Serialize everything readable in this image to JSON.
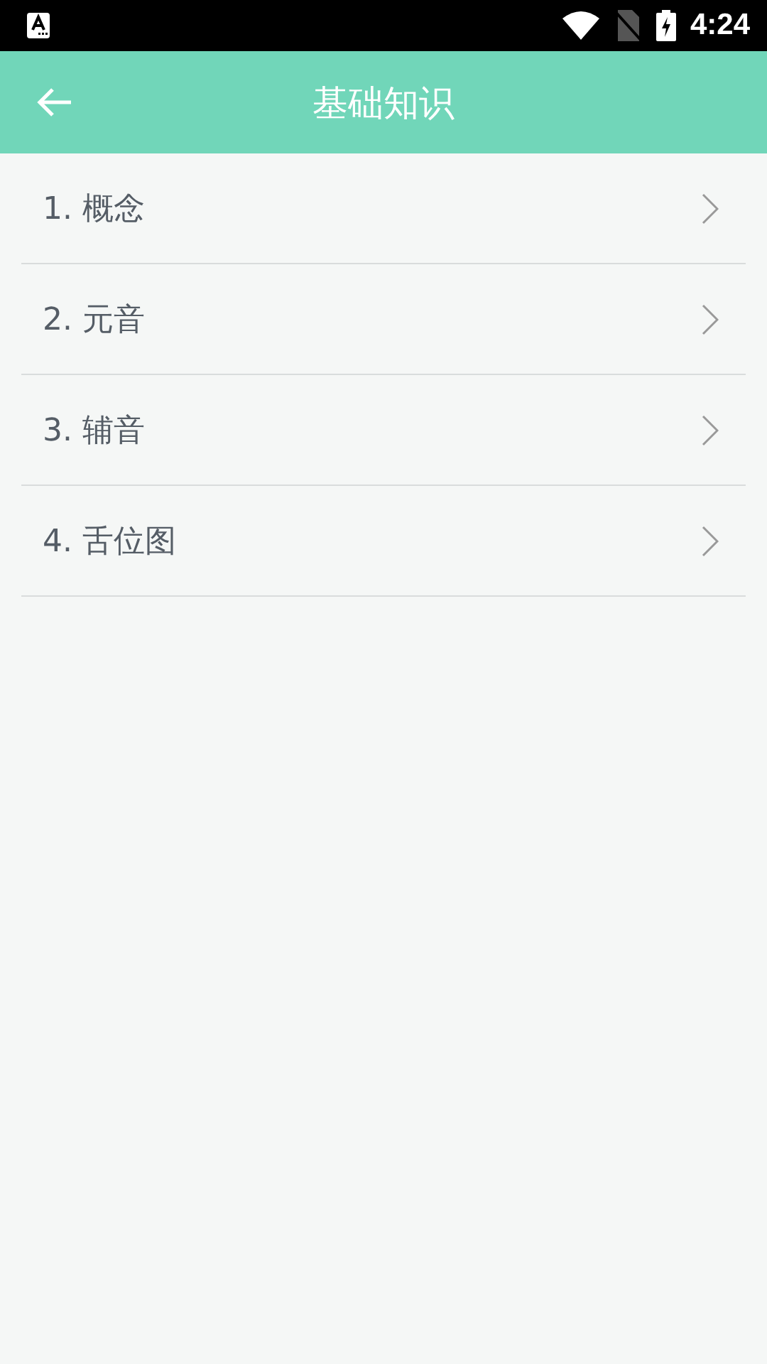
{
  "status_bar": {
    "time": "4:24"
  },
  "app_bar": {
    "title": "基础知识"
  },
  "items": [
    {
      "label": "1. 概念"
    },
    {
      "label": "2. 元音"
    },
    {
      "label": "3. 辅音"
    },
    {
      "label": "4. 舌位图"
    }
  ]
}
